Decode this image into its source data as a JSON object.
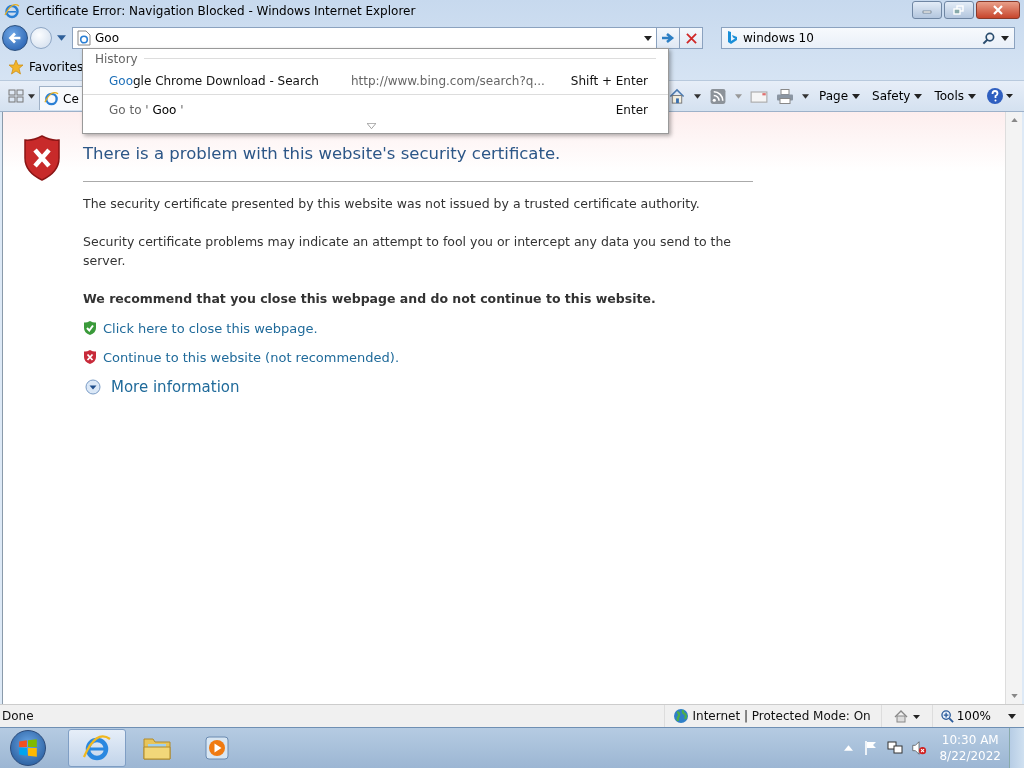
{
  "window": {
    "title": "Certificate Error: Navigation Blocked - Windows Internet Explorer"
  },
  "address": {
    "value": "Goo"
  },
  "search": {
    "value": "windows 10"
  },
  "favorites": {
    "label": "Favorites"
  },
  "tab": {
    "label": "Ce"
  },
  "command_bar": [
    {
      "label": "Page"
    },
    {
      "label": "Safety"
    },
    {
      "label": "Tools"
    }
  ],
  "dropdown": {
    "heading": "History",
    "suggestion": {
      "match": "Goo",
      "rest": "gle Chrome Download - Search",
      "url": "http://www.bing.com/search?q...",
      "shortcut": "Shift + Enter"
    },
    "goto": {
      "prefix": "Go to '",
      "query": "Goo",
      "suffix": "'",
      "shortcut": "Enter"
    }
  },
  "error_page": {
    "heading": "There is a problem with this website's security certificate.",
    "paragraphs": [
      "The security certificate presented by this website was not issued by a trusted certificate authority.",
      "Security certificate problems may indicate an attempt to fool you or intercept any data you send to the server."
    ],
    "recommendation": "We recommend that you close this webpage and do not continue to this website.",
    "links": [
      {
        "kind": "safe",
        "label": "Click here to close this webpage."
      },
      {
        "kind": "unsafe",
        "label": "Continue to this website (not recommended)."
      }
    ],
    "more_info": "More information"
  },
  "status_bar": {
    "text": "Done",
    "zone": "Internet | Protected Mode: On",
    "zoom": "100%"
  },
  "taskbar": {
    "time": "10:30 AM",
    "date": "8/22/2022"
  }
}
